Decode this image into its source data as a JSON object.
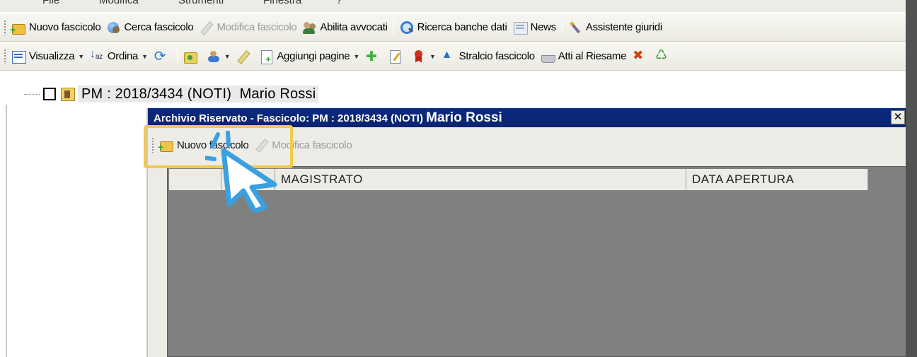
{
  "menubar": {
    "items": [
      "File",
      "Modifica",
      "Strumenti",
      "Finestra",
      "?"
    ]
  },
  "toolbar1": {
    "items": [
      {
        "label": "Nuovo fascicolo",
        "icon": "folder-new-icon",
        "enabled": true
      },
      {
        "label": "Cerca fascicolo",
        "icon": "globe-search-icon",
        "enabled": true
      },
      {
        "label": "Modifica fascicolo",
        "icon": "pencil-icon",
        "enabled": false
      },
      {
        "label": "Abilita avvocati",
        "icon": "users-icon",
        "enabled": true
      },
      {
        "label": "Ricerca banche dati",
        "icon": "search-icon",
        "enabled": true
      },
      {
        "label": "News",
        "icon": "news-icon",
        "enabled": true
      },
      {
        "label": "Assistente giuridi",
        "icon": "wand-icon",
        "enabled": true
      }
    ]
  },
  "toolbar2": {
    "visualizza": "Visualizza",
    "ordina": "Ordina",
    "aggiungi_pagine": "Aggiungi pagine",
    "stralcio": "Stralcio fascicolo",
    "riesame": "Atti al Riesame"
  },
  "tree": {
    "node_label": "PM : 2018/3434 (NOTI)  Mario Rossi"
  },
  "dialog": {
    "title_part1": "Archivio Riservato - Fascicolo: PM : 2018/3434 (NOTI)",
    "title_part2": "Mario Rossi",
    "close": "✕",
    "toolbar": {
      "new_label": "Nuovo fascicolo",
      "edit_label": "Modifica fascicolo"
    },
    "grid": {
      "columns": [
        "",
        "",
        "MAGISTRATO",
        "DATA APERTURA"
      ],
      "rows": []
    }
  },
  "colors": {
    "title_bar": "#0b2a7e",
    "highlight": "#f2c94c",
    "cursor_accent": "#3aa0e0",
    "grid_bg": "#808080"
  }
}
